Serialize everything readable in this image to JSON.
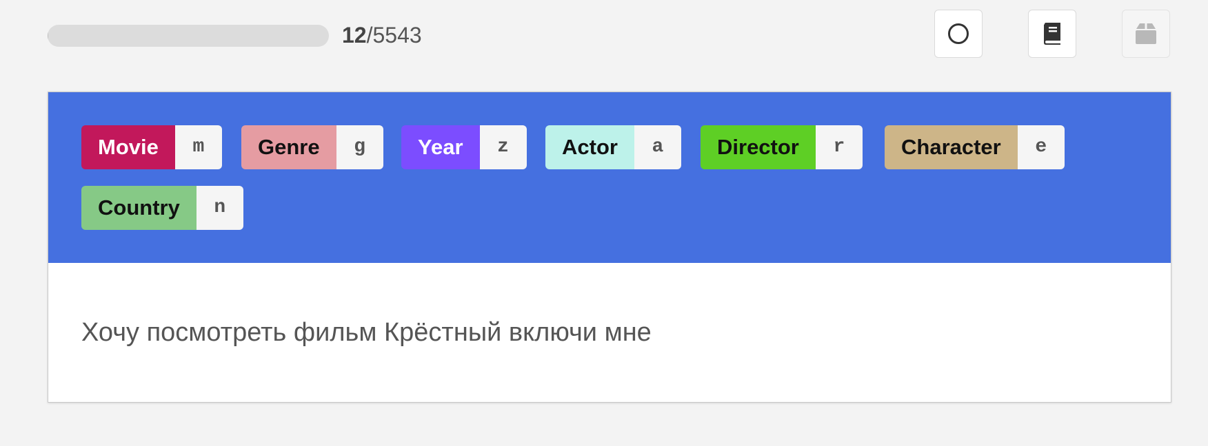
{
  "progress": {
    "current": "12",
    "separator": "/",
    "total": "5543",
    "fraction": 0.0022
  },
  "toolbar": {
    "buttons": [
      {
        "icon": "circle-icon"
      },
      {
        "icon": "book-icon"
      },
      {
        "icon": "archive-box-icon",
        "disabled": true
      }
    ]
  },
  "labels": [
    {
      "name": "Movie",
      "key": "m",
      "bg": "#c2185b",
      "fg": "#ffffff"
    },
    {
      "name": "Genre",
      "key": "g",
      "bg": "#e59ca2",
      "fg": "#111111"
    },
    {
      "name": "Year",
      "key": "z",
      "bg": "#7c4dff",
      "fg": "#ffffff"
    },
    {
      "name": "Actor",
      "key": "a",
      "bg": "#bdf2ea",
      "fg": "#111111"
    },
    {
      "name": "Director",
      "key": "r",
      "bg": "#5ecf25",
      "fg": "#111111"
    },
    {
      "name": "Character",
      "key": "e",
      "bg": "#cdb588",
      "fg": "#111111"
    },
    {
      "name": "Country",
      "key": "n",
      "bg": "#86c986",
      "fg": "#111111"
    }
  ],
  "document": {
    "text": "Хочу посмотреть фильм Крёстный включи мне"
  },
  "colors": {
    "label_area_bg": "#4570e0",
    "page_bg": "#f3f3f3"
  }
}
